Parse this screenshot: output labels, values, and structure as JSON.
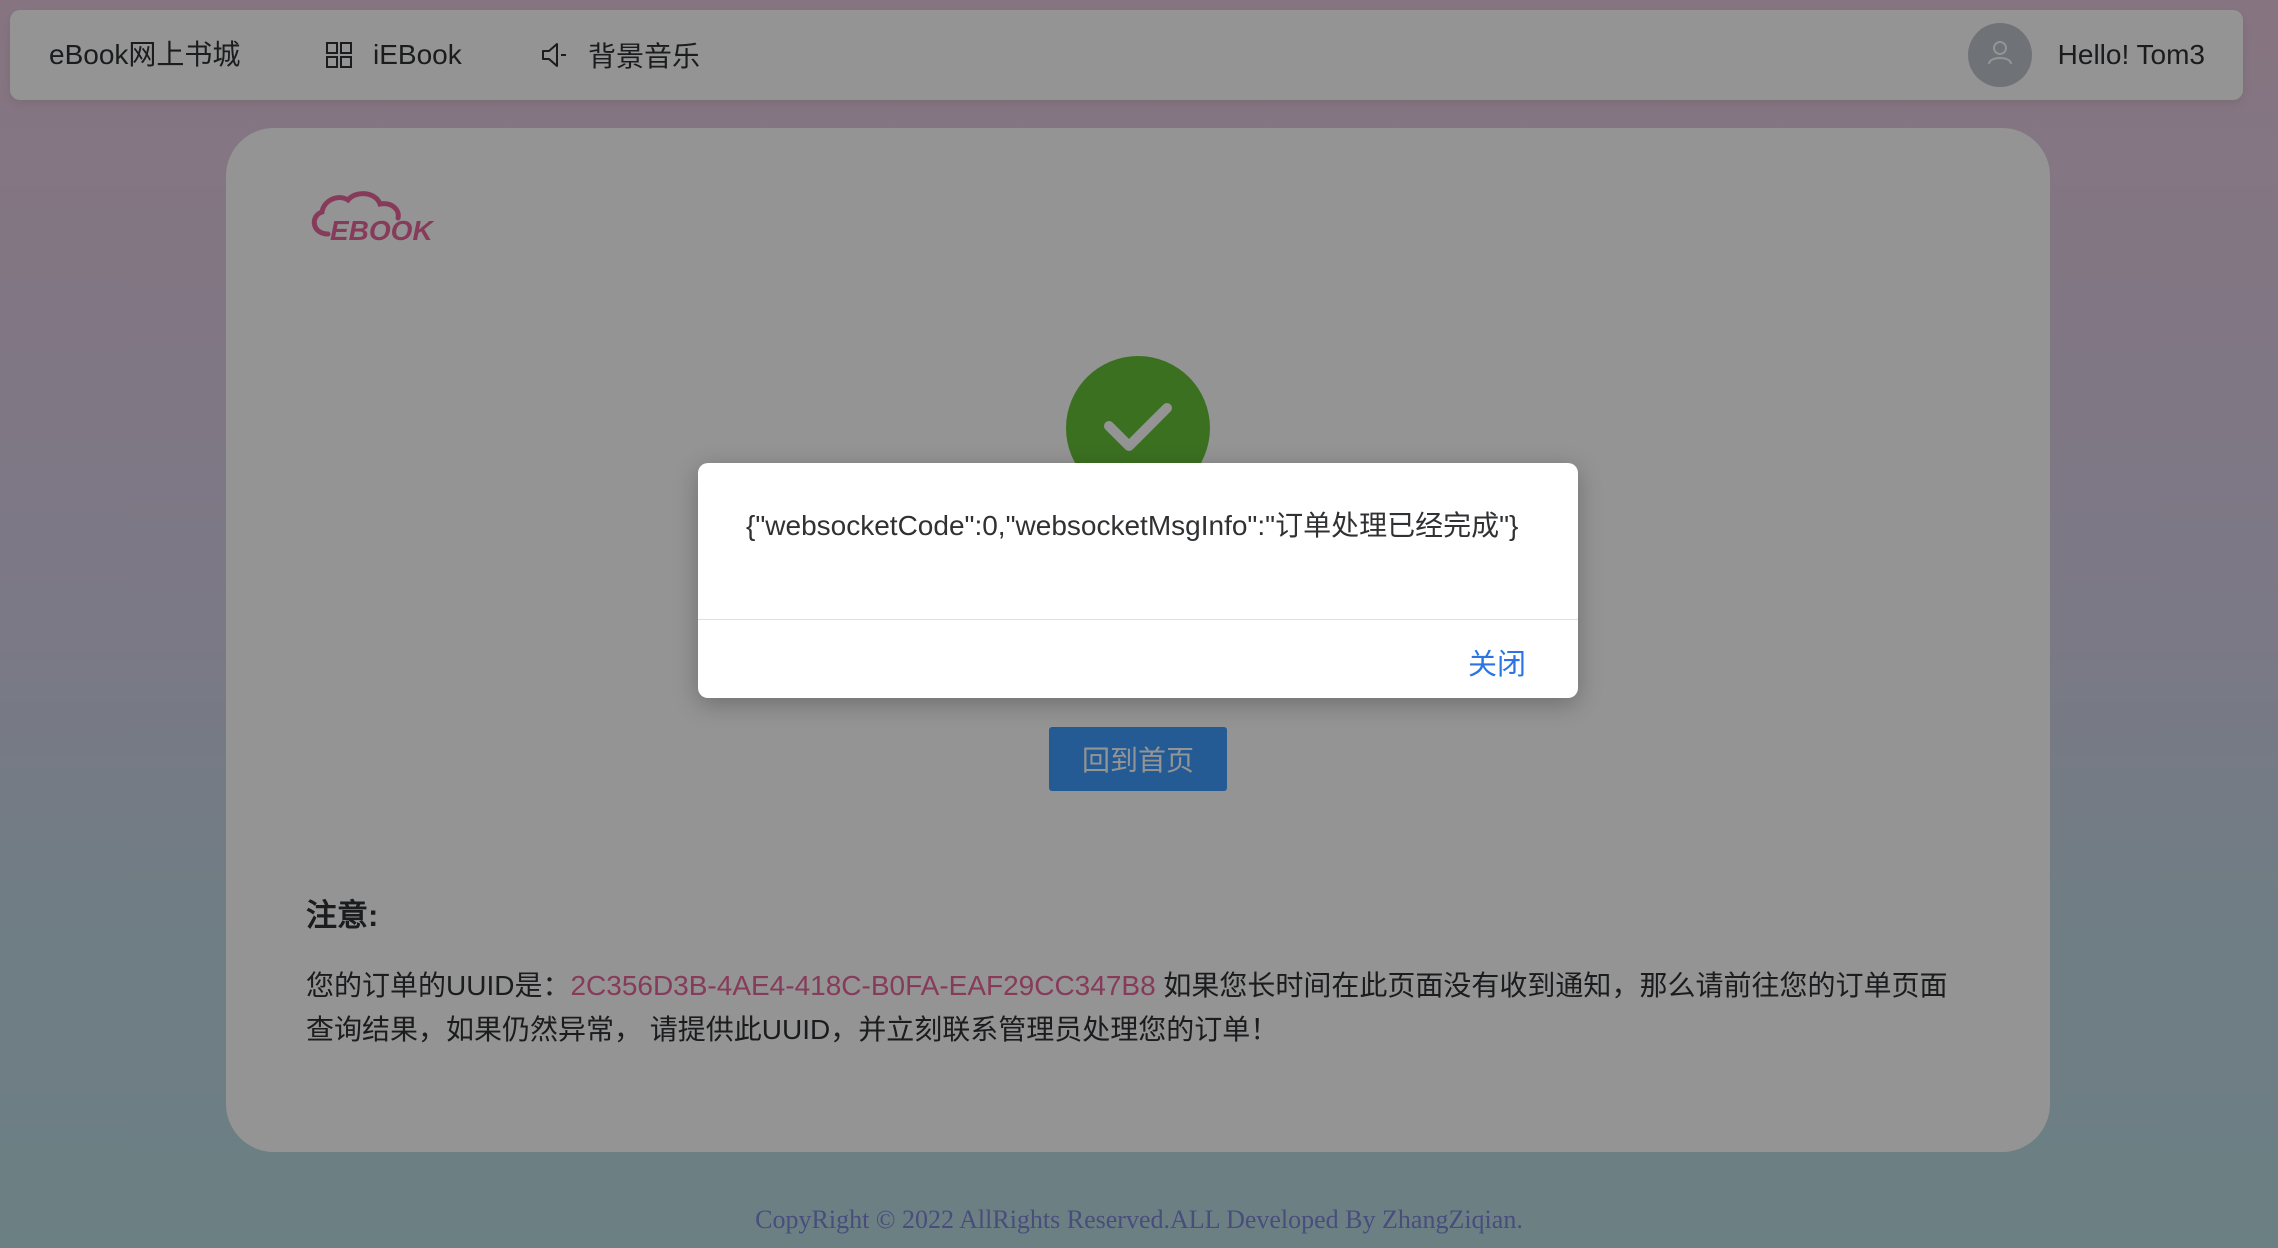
{
  "navbar": {
    "brand": "eBook网上书城",
    "items": [
      {
        "label": "iEBook",
        "icon": "grid-icon"
      },
      {
        "label": "背景音乐",
        "icon": "speaker-icon"
      }
    ],
    "user_greeting": "Hello! Tom3",
    "avatar_icon": "user-icon"
  },
  "main": {
    "logo_text": "EBOOK",
    "success_icon": "check-icon",
    "home_button_label": "回到首页",
    "notice_title": "注意:",
    "notice_prefix": "您的订单的UUID是：",
    "order_uuid": "2C356D3B-4AE4-418C-B0FA-EAF29CC347B8",
    "notice_suffix": " 如果您长时间在此页面没有收到通知，那么请前往您的订单页面查询结果，如果仍然异常， 请提供此UUID，并立刻联系管理员处理您的订单！"
  },
  "footer": {
    "text": "CopyRight © 2022 AllRights Reserved.ALL Developed By ZhangZiqian."
  },
  "dialog": {
    "message": "{\"websocketCode\":0,\"websocketMsgInfo\":\"订单处理已经完成\"}",
    "close_label": "关闭"
  },
  "colors": {
    "primary": "#409eff",
    "success": "#67c23a",
    "uuid": "#e8679b",
    "footer": "#7c86d6",
    "link": "#2a74e6"
  }
}
